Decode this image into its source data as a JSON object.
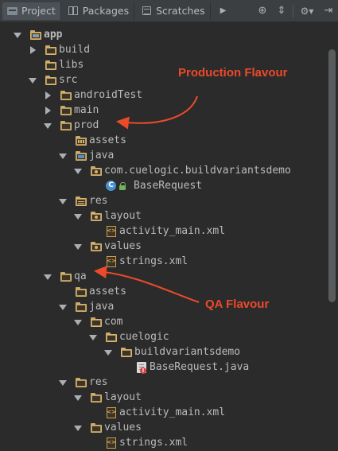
{
  "tabs": [
    {
      "label": "Project",
      "icon": "project-icon",
      "active": true
    },
    {
      "label": "Packages",
      "icon": "packages-icon",
      "active": false
    },
    {
      "label": "Scratches",
      "icon": "scratches-icon",
      "active": false
    }
  ],
  "toolbar": {
    "more_icon": "more-tabs-icon",
    "target_icon": "scroll-from-source-icon",
    "collapse_icon": "collapse-all-icon",
    "settings_icon": "gear-icon",
    "hide_icon": "hide-panel-icon",
    "more_glyph": "▶",
    "target_glyph": "⊕",
    "collapse_glyph": "⇕",
    "settings_glyph": "⚙▾",
    "hide_glyph": "⇥"
  },
  "tree": [
    {
      "label": "app",
      "arrow": "down",
      "icon": "app-folder",
      "bold": true
    },
    {
      "label": "build",
      "arrow": "right",
      "icon": "folder"
    },
    {
      "label": "libs",
      "arrow": "none",
      "icon": "folder"
    },
    {
      "label": "src",
      "arrow": "down",
      "icon": "folder"
    },
    {
      "label": "androidTest",
      "arrow": "right",
      "icon": "folder"
    },
    {
      "label": "main",
      "arrow": "right",
      "icon": "folder"
    },
    {
      "label": "prod",
      "arrow": "down",
      "icon": "folder"
    },
    {
      "label": "assets",
      "arrow": "none",
      "icon": "assets-folder"
    },
    {
      "label": "java",
      "arrow": "down",
      "icon": "source-folder"
    },
    {
      "label": "com.cuelogic.buildvariantsdemo",
      "arrow": "down",
      "icon": "package-folder"
    },
    {
      "label": "BaseRequest",
      "arrow": "none",
      "icon": "class-file"
    },
    {
      "label": "res",
      "arrow": "down",
      "icon": "res-folder"
    },
    {
      "label": "layout",
      "arrow": "down",
      "icon": "package-folder"
    },
    {
      "label": "activity_main.xml",
      "arrow": "none",
      "icon": "xml-file"
    },
    {
      "label": "values",
      "arrow": "down",
      "icon": "package-folder"
    },
    {
      "label": "strings.xml",
      "arrow": "none",
      "icon": "xml-file"
    },
    {
      "label": "qa",
      "arrow": "down",
      "icon": "folder"
    },
    {
      "label": "assets",
      "arrow": "none",
      "icon": "folder"
    },
    {
      "label": "java",
      "arrow": "down",
      "icon": "folder"
    },
    {
      "label": "com",
      "arrow": "down",
      "icon": "folder"
    },
    {
      "label": "cuelogic",
      "arrow": "down",
      "icon": "folder"
    },
    {
      "label": "buildvariantsdemo",
      "arrow": "down",
      "icon": "folder"
    },
    {
      "label": "BaseRequest.java",
      "arrow": "none",
      "icon": "java-file-error"
    },
    {
      "label": "res",
      "arrow": "down",
      "icon": "folder"
    },
    {
      "label": "layout",
      "arrow": "down",
      "icon": "folder"
    },
    {
      "label": "activity_main.xml",
      "arrow": "none",
      "icon": "xml-file"
    },
    {
      "label": "values",
      "arrow": "down",
      "icon": "folder"
    },
    {
      "label": "strings.xml",
      "arrow": "none",
      "icon": "xml-file"
    }
  ],
  "annotations": {
    "production": "Production Flavour",
    "qa": "QA Flavour"
  },
  "colors": {
    "background": "#2b2b2b",
    "toolbar": "#3c3f41",
    "text": "#bbbbbb",
    "annotation": "#ec4a2a",
    "folder": "#b99555"
  }
}
